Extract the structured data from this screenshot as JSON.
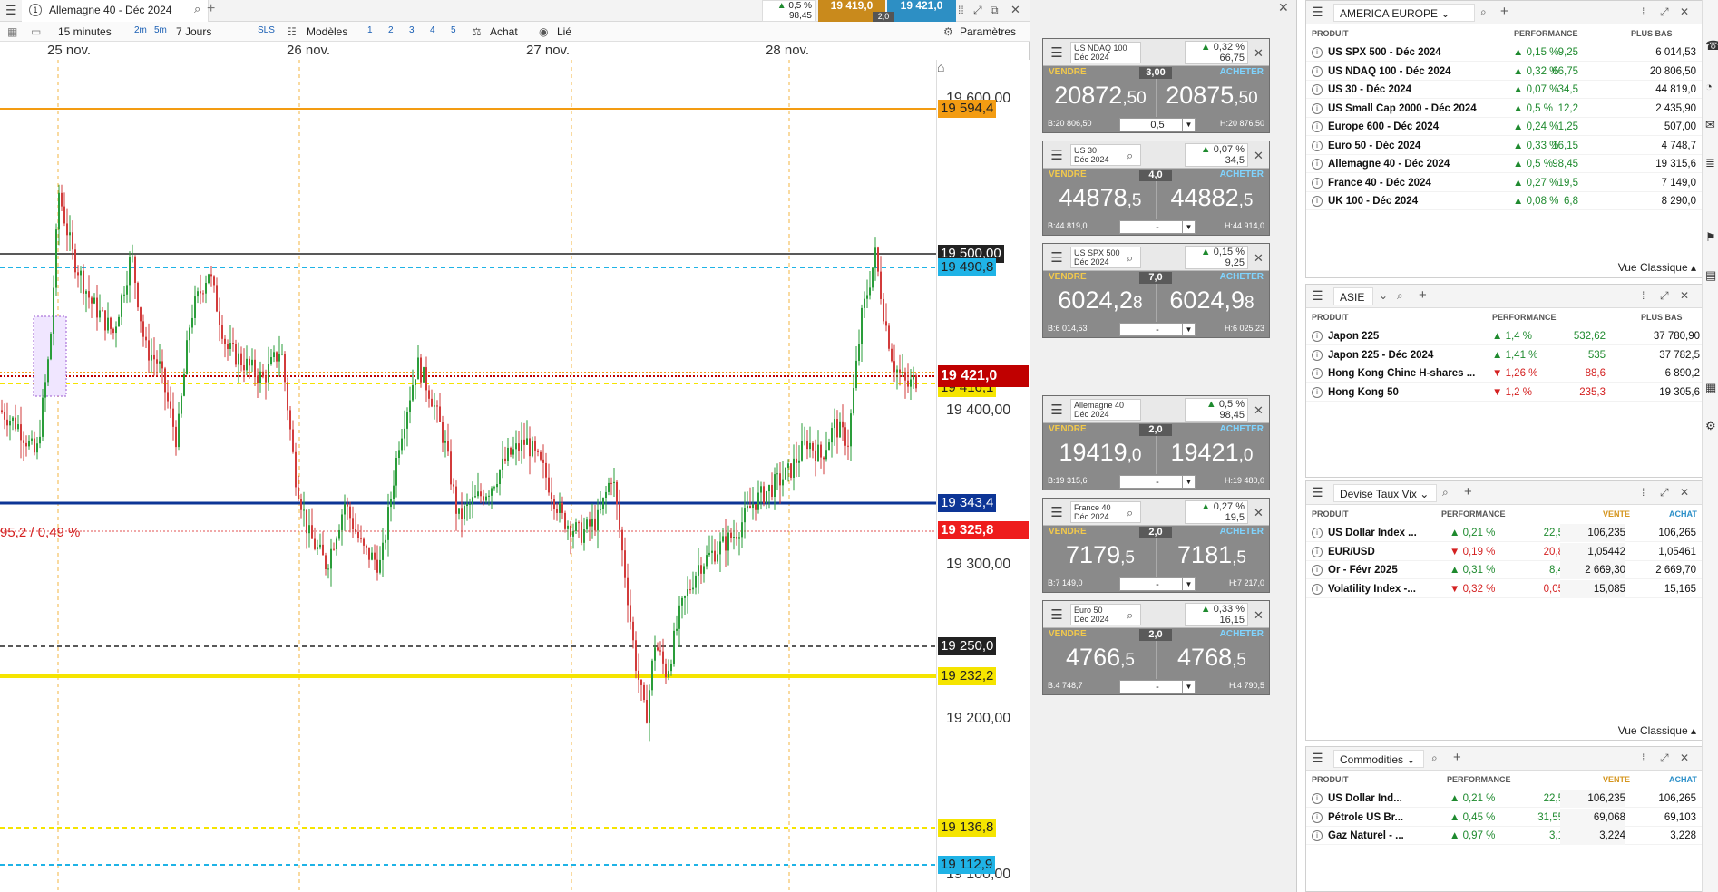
{
  "chart": {
    "tab_number": "1",
    "tab_title": "Allemagne 40 - Déc 2024",
    "add_tab": "+",
    "header_perf": "0,5 %",
    "header_change": "98,45",
    "header_sell": "19 419,0",
    "header_spread": "2,0",
    "header_buy": "19 421,0",
    "toolbar": {
      "interval": "15 minutes",
      "tf_2m": "2m",
      "tf_5m": "5m",
      "range": "7 Jours",
      "sls": "SLS",
      "templates": "Modèles",
      "n1": "1",
      "n2": "2",
      "n3": "3",
      "n4": "4",
      "n5": "5",
      "buy": "Achat",
      "linked": "Lié",
      "settings": "Paramètres"
    },
    "dates": [
      "25 nov.",
      "26 nov.",
      "27 nov.",
      "28 nov."
    ],
    "axis_labels": [
      "19 600,00",
      "19 400,00",
      "19 300,00",
      "19 200,00",
      "19 100,00"
    ],
    "price_lines": {
      "l19594": "19 594,4",
      "l19500": "19 500,00",
      "l19490": "19 490,8",
      "l19421": "19 421,0",
      "l19416": "19 416,1",
      "l19343": "19 343,4",
      "l19325": "19 325,8",
      "l19250": "19 250,0",
      "l19232": "19 232,2",
      "l19136": "19 136,8",
      "l19112": "19 112,9"
    },
    "change_note": "95,2 / 0,49 %",
    "colors": {
      "orange": "#f39c12",
      "cyan": "#1fb3e6",
      "navy": "#0d3596",
      "red": "#c00000",
      "yellow": "#f5e400",
      "up": "#2a9d3a",
      "down": "#d23b3b"
    }
  },
  "tickets": [
    {
      "name1": "US NDAQ 100",
      "name2": "Déc 2024",
      "perf": "0,32 %",
      "chg": "66,75",
      "sell_label": "VENDRE",
      "buy_label": "ACHETER",
      "spread": "3,00",
      "bid_big": "20872",
      "bid_small": ",50",
      "ask_big": "20875",
      "ask_small": ",50",
      "low": "B:20 806,50",
      "high": "H:20 876,50",
      "qty": "0,5"
    },
    {
      "name1": "US 30",
      "name2": "Déc 2024",
      "perf": "0,07 %",
      "chg": "34,5",
      "sell_label": "VENDRE",
      "buy_label": "ACHETER",
      "spread": "4,0",
      "bid_big": "44878",
      "bid_small": ",5",
      "ask_big": "44882",
      "ask_small": ",5",
      "low": "B:44 819,0",
      "high": "H:44 914,0",
      "qty": "-"
    },
    {
      "name1": "US SPX 500",
      "name2": "Déc 2024",
      "perf": "0,15 %",
      "chg": "9,25",
      "sell_label": "VENDRE",
      "buy_label": "ACHETER",
      "spread": "7,0",
      "bid_big": "6024,2",
      "bid_small": "8",
      "ask_big": "6024,9",
      "ask_small": "8",
      "low": "B:6 014,53",
      "high": "H:6 025,23",
      "qty": "-"
    },
    {
      "name1": "Allemagne 40",
      "name2": "Déc 2024",
      "perf": "0,5 %",
      "chg": "98,45",
      "sell_label": "VENDRE",
      "buy_label": "ACHETER",
      "spread": "2,0",
      "bid_big": "19419",
      "bid_small": ",0",
      "ask_big": "19421",
      "ask_small": ",0",
      "low": "B:19 315,6",
      "high": "H:19 480,0",
      "qty": "-"
    },
    {
      "name1": "France 40",
      "name2": "Déc 2024",
      "perf": "0,27 %",
      "chg": "19,5",
      "sell_label": "VENDRE",
      "buy_label": "ACHETER",
      "spread": "2,0",
      "bid_big": "7179",
      "bid_small": ",5",
      "ask_big": "7181",
      "ask_small": ",5",
      "low": "B:7 149,0",
      "high": "H:7 217,0",
      "qty": "-"
    },
    {
      "name1": "Euro 50",
      "name2": "Déc 2024",
      "perf": "0,33 %",
      "chg": "16,15",
      "sell_label": "VENDRE",
      "buy_label": "ACHETER",
      "spread": "2,0",
      "bid_big": "4766",
      "bid_small": ",5",
      "ask_big": "4768",
      "ask_small": ",5",
      "low": "B:4 748,7",
      "high": "H:4 790,5",
      "qty": "-"
    }
  ],
  "watchlists": {
    "america": {
      "title": "AMERICA EUROPE",
      "col_product": "PRODUIT",
      "col_perf": "PERFORMANCE",
      "col_low": "PLUS BAS",
      "footer": "Vue Classique",
      "rows": [
        {
          "name": "US SPX 500 - Déc 2024",
          "perf": "0,15 %",
          "chg": "9,25",
          "low": "6 014,53",
          "dir": "up"
        },
        {
          "name": "US NDAQ 100 - Déc 2024",
          "perf": "0,32 %",
          "chg": "66,75",
          "low": "20 806,50",
          "dir": "up"
        },
        {
          "name": "US 30 - Déc 2024",
          "perf": "0,07 %",
          "chg": "34,5",
          "low": "44 819,0",
          "dir": "up"
        },
        {
          "name": "US Small Cap 2000 - Déc 2024",
          "perf": "0,5 %",
          "chg": "12,2",
          "low": "2 435,90",
          "dir": "up"
        },
        {
          "name": "Europe 600 - Déc 2024",
          "perf": "0,24 %",
          "chg": "1,25",
          "low": "507,00",
          "dir": "up"
        },
        {
          "name": "Euro 50 - Déc 2024",
          "perf": "0,33 %",
          "chg": "16,15",
          "low": "4 748,7",
          "dir": "up"
        },
        {
          "name": "Allemagne 40 - Déc 2024",
          "perf": "0,5 %",
          "chg": "98,45",
          "low": "19 315,6",
          "dir": "up"
        },
        {
          "name": "France 40 - Déc 2024",
          "perf": "0,27 %",
          "chg": "19,5",
          "low": "7 149,0",
          "dir": "up"
        },
        {
          "name": "UK 100 - Déc 2024",
          "perf": "0,08 %",
          "chg": "6,8",
          "low": "8 290,0",
          "dir": "up"
        }
      ]
    },
    "asie": {
      "title": "ASIE",
      "col_product": "PRODUIT",
      "col_perf": "PERFORMANCE",
      "col_low": "PLUS BAS",
      "rows": [
        {
          "name": "Japon 225",
          "perf": "1,4 %",
          "chg": "532,62",
          "low": "37 780,90",
          "dir": "up"
        },
        {
          "name": "Japon 225 - Déc 2024",
          "perf": "1,41 %",
          "chg": "535",
          "low": "37 782,5",
          "dir": "up"
        },
        {
          "name": "Hong Kong Chine H-shares ...",
          "perf": "1,26 %",
          "chg": "88,6",
          "low": "6 890,2",
          "dir": "dn"
        },
        {
          "name": "Hong Kong 50",
          "perf": "1,2 %",
          "chg": "235,3",
          "low": "19 305,6",
          "dir": "dn"
        }
      ]
    },
    "devise": {
      "title": "Devise Taux Vix",
      "col_product": "PRODUIT",
      "col_perf": "PERFORMANCE",
      "col_sell": "VENTE",
      "col_buy": "ACHAT",
      "footer": "Vue Classique",
      "rows": [
        {
          "name": "US Dollar Index ...",
          "perf": "0,21 %",
          "chg": "22,5",
          "sell": "106,235",
          "buy": "106,265",
          "dir": "up"
        },
        {
          "name": "EUR/USD",
          "perf": "0,19 %",
          "chg": "20,8",
          "sell": "1,05442",
          "buy": "1,05461",
          "dir": "dn"
        },
        {
          "name": "Or - Févr 2025",
          "perf": "0,31 %",
          "chg": "8,4",
          "sell": "2 669,30",
          "buy": "2 669,70",
          "dir": "up"
        },
        {
          "name": "Volatility Index -...",
          "perf": "0,32 %",
          "chg": "0,05",
          "sell": "15,085",
          "buy": "15,165",
          "dir": "dn"
        }
      ]
    },
    "commodities": {
      "title": "Commodities",
      "col_product": "PRODUIT",
      "col_perf": "PERFORMANCE",
      "col_sell": "VENTE",
      "col_buy": "ACHAT",
      "rows": [
        {
          "name": "US Dollar Ind...",
          "perf": "0,21 %",
          "chg": "22,5",
          "sell": "106,235",
          "buy": "106,265",
          "dir": "up"
        },
        {
          "name": "Pétrole US Br...",
          "perf": "0,45 %",
          "chg": "31,55",
          "sell": "69,068",
          "buy": "69,103",
          "dir": "up"
        },
        {
          "name": "Gaz Naturel - ...",
          "perf": "0,97 %",
          "chg": "3,1",
          "sell": "3,224",
          "buy": "3,228",
          "dir": "up"
        }
      ]
    }
  }
}
